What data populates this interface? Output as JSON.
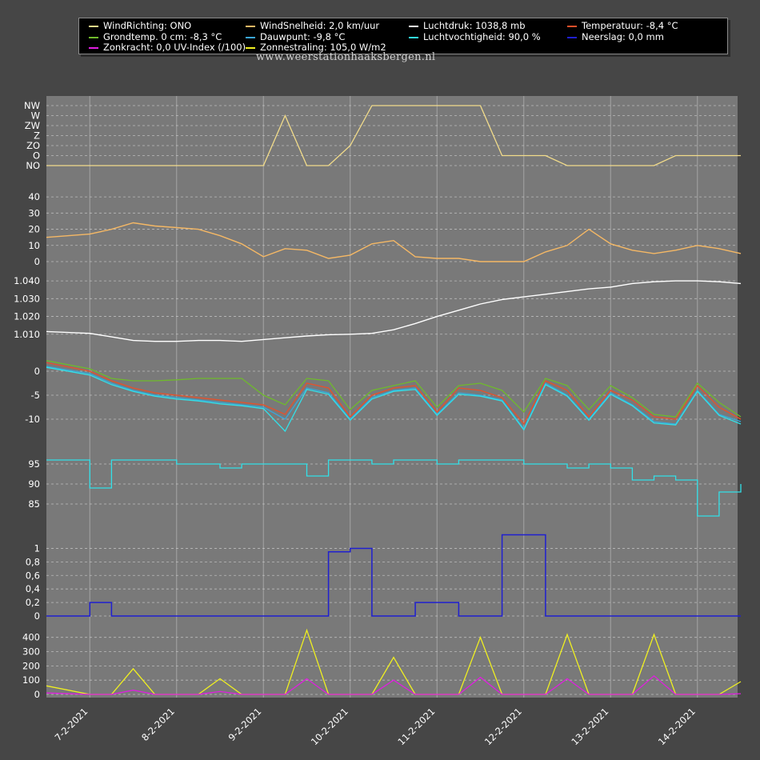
{
  "legend": {
    "items": [
      {
        "label": "WindRichting: ONO",
        "color": "#f2dc8a"
      },
      {
        "label": "WindSnelheid: 2,0 km/uur",
        "color": "#f5b865"
      },
      {
        "label": "Luchtdruk: 1038,8 mb",
        "color": "#ffffff"
      },
      {
        "label": "Temperatuur: -8,4 °C",
        "color": "#e8502a"
      },
      {
        "label": "Grondtemp. 0 cm: -8,3 °C",
        "color": "#6fba2c"
      },
      {
        "label": "Dauwpunt: -9,8 °C",
        "color": "#3aa6d8"
      },
      {
        "label": "Luchtvochtigheid: 90,0 %",
        "color": "#32e0e8"
      },
      {
        "label": "Neerslag: 0,0 mm",
        "color": "#2020d0"
      },
      {
        "label": "Zonkracht: 0,0 UV-Index (/100)",
        "color": "#e01ee0"
      },
      {
        "label": "Zonnestraling: 105,0 W/m2",
        "color": "#f0f020"
      }
    ]
  },
  "watermark": "www.weerstationhaaksbergen.nl",
  "chart_data": [
    {
      "type": "line",
      "name": "WindRichting",
      "yticks": [
        "NO",
        "O",
        "ZO",
        "Z",
        "ZW",
        "W",
        "NW"
      ],
      "x_dates": [
        "2021-02-06 12:00",
        "2021-02-07",
        "2021-02-07 06:00",
        "2021-02-07 12:00",
        "2021-02-07 18:00",
        "2021-02-08",
        "2021-02-08 06:00",
        "2021-02-08 12:00",
        "2021-02-08 18:00",
        "2021-02-09",
        "2021-02-09 06:00",
        "2021-02-09 12:00",
        "2021-02-09 18:00",
        "2021-02-10",
        "2021-02-10 06:00",
        "2021-02-10 12:00",
        "2021-02-10 18:00",
        "2021-02-11",
        "2021-02-11 06:00",
        "2021-02-11 12:00",
        "2021-02-11 18:00",
        "2021-02-12",
        "2021-02-12 06:00",
        "2021-02-12 12:00",
        "2021-02-12 18:00",
        "2021-02-13",
        "2021-02-13 06:00",
        "2021-02-13 12:00",
        "2021-02-13 18:00",
        "2021-02-14",
        "2021-02-14 06:00",
        "2021-02-14 12:00"
      ],
      "values": [
        "NO",
        "NO",
        "NO",
        "NO",
        "NO",
        "NO",
        "NO",
        "NO",
        "NO",
        "NO",
        "W",
        "NO",
        "NO",
        "ZO",
        "NW",
        "NW",
        "NW",
        "NW",
        "NW",
        "NW",
        "O",
        "O",
        "O",
        "NO",
        "NO",
        "NO",
        "NO",
        "NO",
        "O",
        "O",
        "O",
        "O"
      ],
      "color": "#f2dc8a"
    },
    {
      "type": "line",
      "name": "WindSnelheid",
      "ylim": [
        0,
        45
      ],
      "yticks": [
        0,
        10,
        20,
        30,
        40
      ],
      "x_dates": [
        "2021-02-06 12:00",
        "2021-02-07",
        "2021-02-07 06:00",
        "2021-02-07 12:00",
        "2021-02-07 18:00",
        "2021-02-08",
        "2021-02-08 06:00",
        "2021-02-08 12:00",
        "2021-02-08 18:00",
        "2021-02-09",
        "2021-02-09 06:00",
        "2021-02-09 12:00",
        "2021-02-09 18:00",
        "2021-02-10",
        "2021-02-10 06:00",
        "2021-02-10 12:00",
        "2021-02-10 18:00",
        "2021-02-11",
        "2021-02-11 06:00",
        "2021-02-11 12:00",
        "2021-02-11 18:00",
        "2021-02-12",
        "2021-02-12 06:00",
        "2021-02-12 12:00",
        "2021-02-12 18:00",
        "2021-02-13",
        "2021-02-13 06:00",
        "2021-02-13 12:00",
        "2021-02-13 18:00",
        "2021-02-14",
        "2021-02-14 06:00",
        "2021-02-14 12:00"
      ],
      "values": [
        15,
        17,
        20,
        24,
        22,
        21,
        20,
        16,
        11,
        3,
        8,
        7,
        2,
        4,
        11,
        13,
        3,
        2,
        2,
        0,
        0,
        0,
        6,
        10,
        20,
        11,
        7,
        5,
        7,
        10,
        8,
        5
      ],
      "color": "#f5b865"
    },
    {
      "type": "line",
      "name": "Luchtdruk",
      "ylim": [
        1.0,
        1.045
      ],
      "yticks": [
        "1.010",
        "1.020",
        "1.030",
        "1.040"
      ],
      "x_dates": [
        "2021-02-06 12:00",
        "2021-02-07",
        "2021-02-07 06:00",
        "2021-02-07 12:00",
        "2021-02-07 18:00",
        "2021-02-08",
        "2021-02-08 06:00",
        "2021-02-08 12:00",
        "2021-02-08 18:00",
        "2021-02-09",
        "2021-02-09 06:00",
        "2021-02-09 12:00",
        "2021-02-09 18:00",
        "2021-02-10",
        "2021-02-10 06:00",
        "2021-02-10 12:00",
        "2021-02-10 18:00",
        "2021-02-11",
        "2021-02-11 06:00",
        "2021-02-11 12:00",
        "2021-02-11 18:00",
        "2021-02-12",
        "2021-02-12 06:00",
        "2021-02-12 12:00",
        "2021-02-12 18:00",
        "2021-02-13",
        "2021-02-13 06:00",
        "2021-02-13 12:00",
        "2021-02-13 18:00",
        "2021-02-14",
        "2021-02-14 06:00",
        "2021-02-14 12:00"
      ],
      "values": [
        1.0115,
        1.0105,
        1.0085,
        1.0065,
        1.006,
        1.006,
        1.0065,
        1.0065,
        1.006,
        1.007,
        1.008,
        1.009,
        1.0097,
        1.01,
        1.0105,
        1.0125,
        1.016,
        1.02,
        1.0235,
        1.027,
        1.0295,
        1.031,
        1.0325,
        1.034,
        1.0355,
        1.0365,
        1.0385,
        1.0395,
        1.04,
        1.04,
        1.0395,
        1.0385
      ],
      "color": "#ffffff"
    },
    {
      "type": "line",
      "name": "Temperaturen",
      "ylim": [
        -14,
        3
      ],
      "yticks": [
        0,
        -5,
        -10
      ],
      "x_dates": [
        "2021-02-06 12:00",
        "2021-02-07",
        "2021-02-07 06:00",
        "2021-02-07 12:00",
        "2021-02-07 18:00",
        "2021-02-08",
        "2021-02-08 06:00",
        "2021-02-08 12:00",
        "2021-02-08 18:00",
        "2021-02-09",
        "2021-02-09 06:00",
        "2021-02-09 12:00",
        "2021-02-09 18:00",
        "2021-02-10",
        "2021-02-10 06:00",
        "2021-02-10 12:00",
        "2021-02-10 18:00",
        "2021-02-11",
        "2021-02-11 06:00",
        "2021-02-11 12:00",
        "2021-02-11 18:00",
        "2021-02-12",
        "2021-02-12 06:00",
        "2021-02-12 12:00",
        "2021-02-12 18:00",
        "2021-02-13",
        "2021-02-13 06:00",
        "2021-02-13 12:00",
        "2021-02-13 18:00",
        "2021-02-14",
        "2021-02-14 06:00",
        "2021-02-14 12:00"
      ],
      "series": [
        {
          "name": "Grondtemp. 0 cm",
          "color": "#6fba2c",
          "values": [
            2.2,
            0.5,
            -1.5,
            -2.0,
            -2.0,
            -1.8,
            -1.5,
            -1.5,
            -1.5,
            -5.0,
            -7.0,
            -1.5,
            -2.0,
            -8.0,
            -4.0,
            -3.0,
            -2.0,
            -7.5,
            -3.0,
            -2.5,
            -4.0,
            -8.5,
            -1.5,
            -3.0,
            -8.0,
            -3.0,
            -5.5,
            -9.0,
            -9.5,
            -2.5,
            -6.5,
            -9.5
          ]
        },
        {
          "name": "Temperatuur",
          "color": "#e8502a",
          "values": [
            1.8,
            0.0,
            -2.0,
            -3.5,
            -4.5,
            -5.0,
            -5.5,
            -6.0,
            -6.5,
            -7.0,
            -9.0,
            -2.5,
            -3.5,
            -9.5,
            -5.0,
            -3.5,
            -3.0,
            -8.5,
            -3.5,
            -4.0,
            -5.5,
            -11.0,
            -2.0,
            -4.0,
            -9.5,
            -4.0,
            -6.0,
            -9.5,
            -10.0,
            -3.0,
            -7.5,
            -10.0
          ]
        },
        {
          "name": "Dauwpunt",
          "color": "#3aa6d8",
          "values": [
            1.0,
            -0.5,
            -2.5,
            -4.0,
            -5.0,
            -5.5,
            -6.0,
            -6.5,
            -7.0,
            -7.5,
            -10.0,
            -3.5,
            -4.5,
            -10.0,
            -5.5,
            -4.0,
            -3.5,
            -9.0,
            -4.5,
            -5.0,
            -6.0,
            -12.0,
            -2.5,
            -5.0,
            -10.0,
            -4.5,
            -7.0,
            -10.5,
            -11.0,
            -4.0,
            -9.0,
            -10.5
          ]
        },
        {
          "name": "Luchtvochtigheid (als temp)",
          "color": "#32e0e8",
          "values": [
            0.8,
            -0.8,
            -2.8,
            -4.2,
            -5.2,
            -5.8,
            -6.2,
            -6.8,
            -7.2,
            -7.8,
            -12.5,
            -3.8,
            -4.8,
            -10.2,
            -5.8,
            -4.2,
            -3.8,
            -9.2,
            -4.8,
            -5.2,
            -6.2,
            -12.2,
            -2.8,
            -5.2,
            -10.2,
            -4.8,
            -7.2,
            -10.8,
            -11.2,
            -4.2,
            -9.2,
            -11.0
          ]
        }
      ]
    },
    {
      "type": "line",
      "name": "Luchtvochtigheid",
      "ylim": [
        80,
        99
      ],
      "yticks": [
        95,
        90,
        85
      ],
      "x_dates": [
        "2021-02-06 12:00",
        "2021-02-07",
        "2021-02-07 06:00",
        "2021-02-07 12:00",
        "2021-02-07 18:00",
        "2021-02-08",
        "2021-02-08 06:00",
        "2021-02-08 12:00",
        "2021-02-08 18:00",
        "2021-02-09",
        "2021-02-09 06:00",
        "2021-02-09 12:00",
        "2021-02-09 18:00",
        "2021-02-10",
        "2021-02-10 06:00",
        "2021-02-10 12:00",
        "2021-02-10 18:00",
        "2021-02-11",
        "2021-02-11 06:00",
        "2021-02-11 12:00",
        "2021-02-11 18:00",
        "2021-02-12",
        "2021-02-12 06:00",
        "2021-02-12 12:00",
        "2021-02-12 18:00",
        "2021-02-13",
        "2021-02-13 06:00",
        "2021-02-13 12:00",
        "2021-02-13 18:00",
        "2021-02-14",
        "2021-02-14 06:00",
        "2021-02-14 12:00"
      ],
      "values": [
        96,
        89,
        96,
        96,
        96,
        95,
        95,
        94,
        95,
        95,
        95,
        92,
        96,
        96,
        95,
        96,
        96,
        95,
        96,
        96,
        96,
        95,
        95,
        94,
        95,
        94,
        91,
        92,
        91,
        82,
        88,
        90
      ],
      "color": "#32e0e8"
    },
    {
      "type": "line",
      "name": "Neerslag",
      "ylim": [
        0,
        1.1
      ],
      "yticks": [
        "0",
        "0,2",
        "0,4",
        "0,6",
        "0,8",
        "1"
      ],
      "x_dates": [
        "2021-02-06 12:00",
        "2021-02-07",
        "2021-02-07 06:00",
        "2021-02-07 12:00",
        "2021-02-07 18:00",
        "2021-02-08",
        "2021-02-08 06:00",
        "2021-02-08 12:00",
        "2021-02-08 18:00",
        "2021-02-09",
        "2021-02-09 06:00",
        "2021-02-09 12:00",
        "2021-02-09 18:00",
        "2021-02-10",
        "2021-02-10 06:00",
        "2021-02-10 12:00",
        "2021-02-10 18:00",
        "2021-02-11",
        "2021-02-11 06:00",
        "2021-02-11 12:00",
        "2021-02-11 18:00",
        "2021-02-12",
        "2021-02-12 06:00",
        "2021-02-12 12:00",
        "2021-02-12 18:00",
        "2021-02-13",
        "2021-02-13 06:00",
        "2021-02-13 12:00",
        "2021-02-13 18:00",
        "2021-02-14",
        "2021-02-14 06:00",
        "2021-02-14 12:00"
      ],
      "values": [
        0,
        0.2,
        0,
        0,
        0,
        0,
        0,
        0,
        0,
        0,
        0,
        0,
        0.95,
        1.0,
        0,
        0,
        0.2,
        0.2,
        0,
        0,
        1.2,
        1.2,
        0,
        0,
        0,
        0,
        0,
        0,
        0,
        0,
        0,
        0
      ],
      "color": "#2020d0"
    },
    {
      "type": "line",
      "name": "Zon",
      "ylim": [
        0,
        460
      ],
      "yticks": [
        0,
        100,
        200,
        300,
        400
      ],
      "x_dates": [
        "2021-02-06 12:00",
        "2021-02-07",
        "2021-02-07 06:00",
        "2021-02-07 12:00",
        "2021-02-07 18:00",
        "2021-02-08",
        "2021-02-08 06:00",
        "2021-02-08 12:00",
        "2021-02-08 18:00",
        "2021-02-09",
        "2021-02-09 06:00",
        "2021-02-09 12:00",
        "2021-02-09 18:00",
        "2021-02-10",
        "2021-02-10 06:00",
        "2021-02-10 12:00",
        "2021-02-10 18:00",
        "2021-02-11",
        "2021-02-11 06:00",
        "2021-02-11 12:00",
        "2021-02-11 18:00",
        "2021-02-12",
        "2021-02-12 06:00",
        "2021-02-12 12:00",
        "2021-02-12 18:00",
        "2021-02-13",
        "2021-02-13 06:00",
        "2021-02-13 12:00",
        "2021-02-13 18:00",
        "2021-02-14",
        "2021-02-14 06:00",
        "2021-02-14 12:00"
      ],
      "series": [
        {
          "name": "Zonnestraling",
          "color": "#f0f020",
          "values": [
            60,
            0,
            0,
            180,
            0,
            0,
            0,
            110,
            0,
            0,
            0,
            450,
            0,
            0,
            0,
            260,
            0,
            0,
            0,
            400,
            0,
            0,
            0,
            420,
            0,
            0,
            0,
            420,
            0,
            0,
            0,
            90
          ]
        },
        {
          "name": "Zonkracht",
          "color": "#e01ee0",
          "values": [
            10,
            0,
            0,
            30,
            0,
            0,
            0,
            20,
            0,
            0,
            0,
            110,
            0,
            0,
            0,
            100,
            0,
            0,
            0,
            120,
            0,
            0,
            0,
            110,
            0,
            0,
            0,
            130,
            0,
            0,
            0,
            5
          ]
        }
      ]
    }
  ],
  "x_axis": {
    "ticks": [
      "7-2-2021",
      "8-2-2021",
      "9-2-2021",
      "10-2-2021",
      "11-2-2021",
      "12-2-2021",
      "13-2-2021",
      "14-2-2021"
    ]
  }
}
